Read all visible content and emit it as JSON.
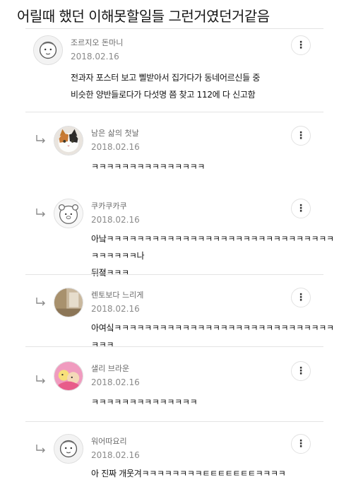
{
  "post_title": "어릴때 했던 이해못할일들 그런거였던거같음",
  "comments": [
    {
      "nickname": "조르지오 돈마니",
      "date": "2018.02.16",
      "lines": [
        "전과자 포스터 보고 삘받아서 집가다가 동네어르신들 중",
        "비슷한 양반들로다가 다섯명 쯤 찾고 112에 다 신고함"
      ],
      "avatar_icon": "kakao-friend-avatar-icon",
      "more_label": "⋮"
    },
    {
      "nickname": "남은 삶의 첫날",
      "date": "2018.02.16",
      "lines": [
        "ㅋㅋㅋㅋㅋㅋㅋㅋㅋㅋㅋㅋㅋㅋㅋ"
      ],
      "avatar_icon": "cat-photo-avatar-icon",
      "more_label": "⋮"
    },
    {
      "nickname": "쿠카쿠카쿠",
      "date": "2018.02.16",
      "lines": [
        "아낰ㅋㅋㅋㅋㅋㅋㅋㅋㅋㅋㅋㅋㅋㅋㅋㅋㅋㅋㅋㅋㅋㅋㅋㅋㅋㅋㅋㅋㅋㅋㅋㅋㅋㅋㅋㅋ나",
        "뒤졐ㅋㅋㅋ"
      ],
      "avatar_icon": "kakao-bear-avatar-icon",
      "more_label": "⋮"
    },
    {
      "nickname": "렌토보다 느리게",
      "date": "2018.02.16",
      "lines": [
        "아여싴ㅋㅋㅋㅋㅋㅋㅋㅋㅋㅋㅋㅋㅋㅋㅋㅋㅋㅋㅋㅋㅋㅋㅋㅋㅋㅋㅋㅋㅋㅋㅋㅋ"
      ],
      "avatar_icon": "room-photo-avatar-icon",
      "more_label": "⋮"
    },
    {
      "nickname": "샐리 브라운",
      "date": "2018.02.16",
      "lines": [
        "ㅋㅋㅋㅋㅋㅋㅋㅋㅋㅋㅋㅋㅋㅋ"
      ],
      "avatar_icon": "cartoon-avatar-icon",
      "more_label": "⋮"
    },
    {
      "nickname": "워어따요리",
      "date": "2018.02.16",
      "lines": [
        "아 진짜 개웃겨ㅋㅋㅋㅋㅋㅋㅋㅋㅌㅌㅌㅌㅌㅌㅌㅋㅋㅋㅋ"
      ],
      "avatar_icon": "kakao-friend-avatar-icon",
      "more_label": "⋮"
    }
  ]
}
